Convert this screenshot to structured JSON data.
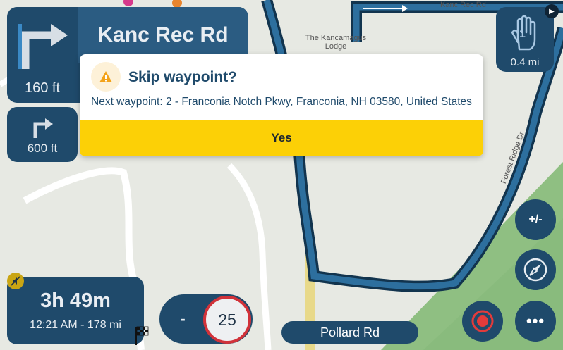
{
  "map": {
    "labels": {
      "poi_line1": "The Kancamagus",
      "poi_line2": "Lodge",
      "road_top": "Kanc Rec Rd",
      "road_side": "Forest Ridge Dr"
    }
  },
  "navigation": {
    "current_turn": {
      "street": "Kanc Rec Rd",
      "distance": "160 ft",
      "icon": "turn-right-icon"
    },
    "next_turn": {
      "distance": "600 ft",
      "icon": "turn-right-icon"
    },
    "waypoint": {
      "distance": "0.4 mi",
      "number": "1",
      "icon": "hand-waypoint-icon"
    },
    "eta": {
      "duration": "3h 49m",
      "arrival": "12:21 AM - 178 mi"
    },
    "speed": {
      "minus_label": "-",
      "limit": "25"
    },
    "current_street": "Pollard Rd"
  },
  "controls": {
    "zoom_label": "+/-",
    "more_label": "•••"
  },
  "dialog": {
    "title": "Skip waypoint?",
    "message": "Next waypoint: 2 - Franconia Notch Pkwy, Franconia, NH 03580, United States",
    "confirm_label": "Yes"
  },
  "colors": {
    "panel": "#1f4a6b",
    "accent_yellow": "#fcd006",
    "route": "#1e5a86",
    "speed_ring": "#d1323a",
    "forest": "#8fbf82"
  }
}
